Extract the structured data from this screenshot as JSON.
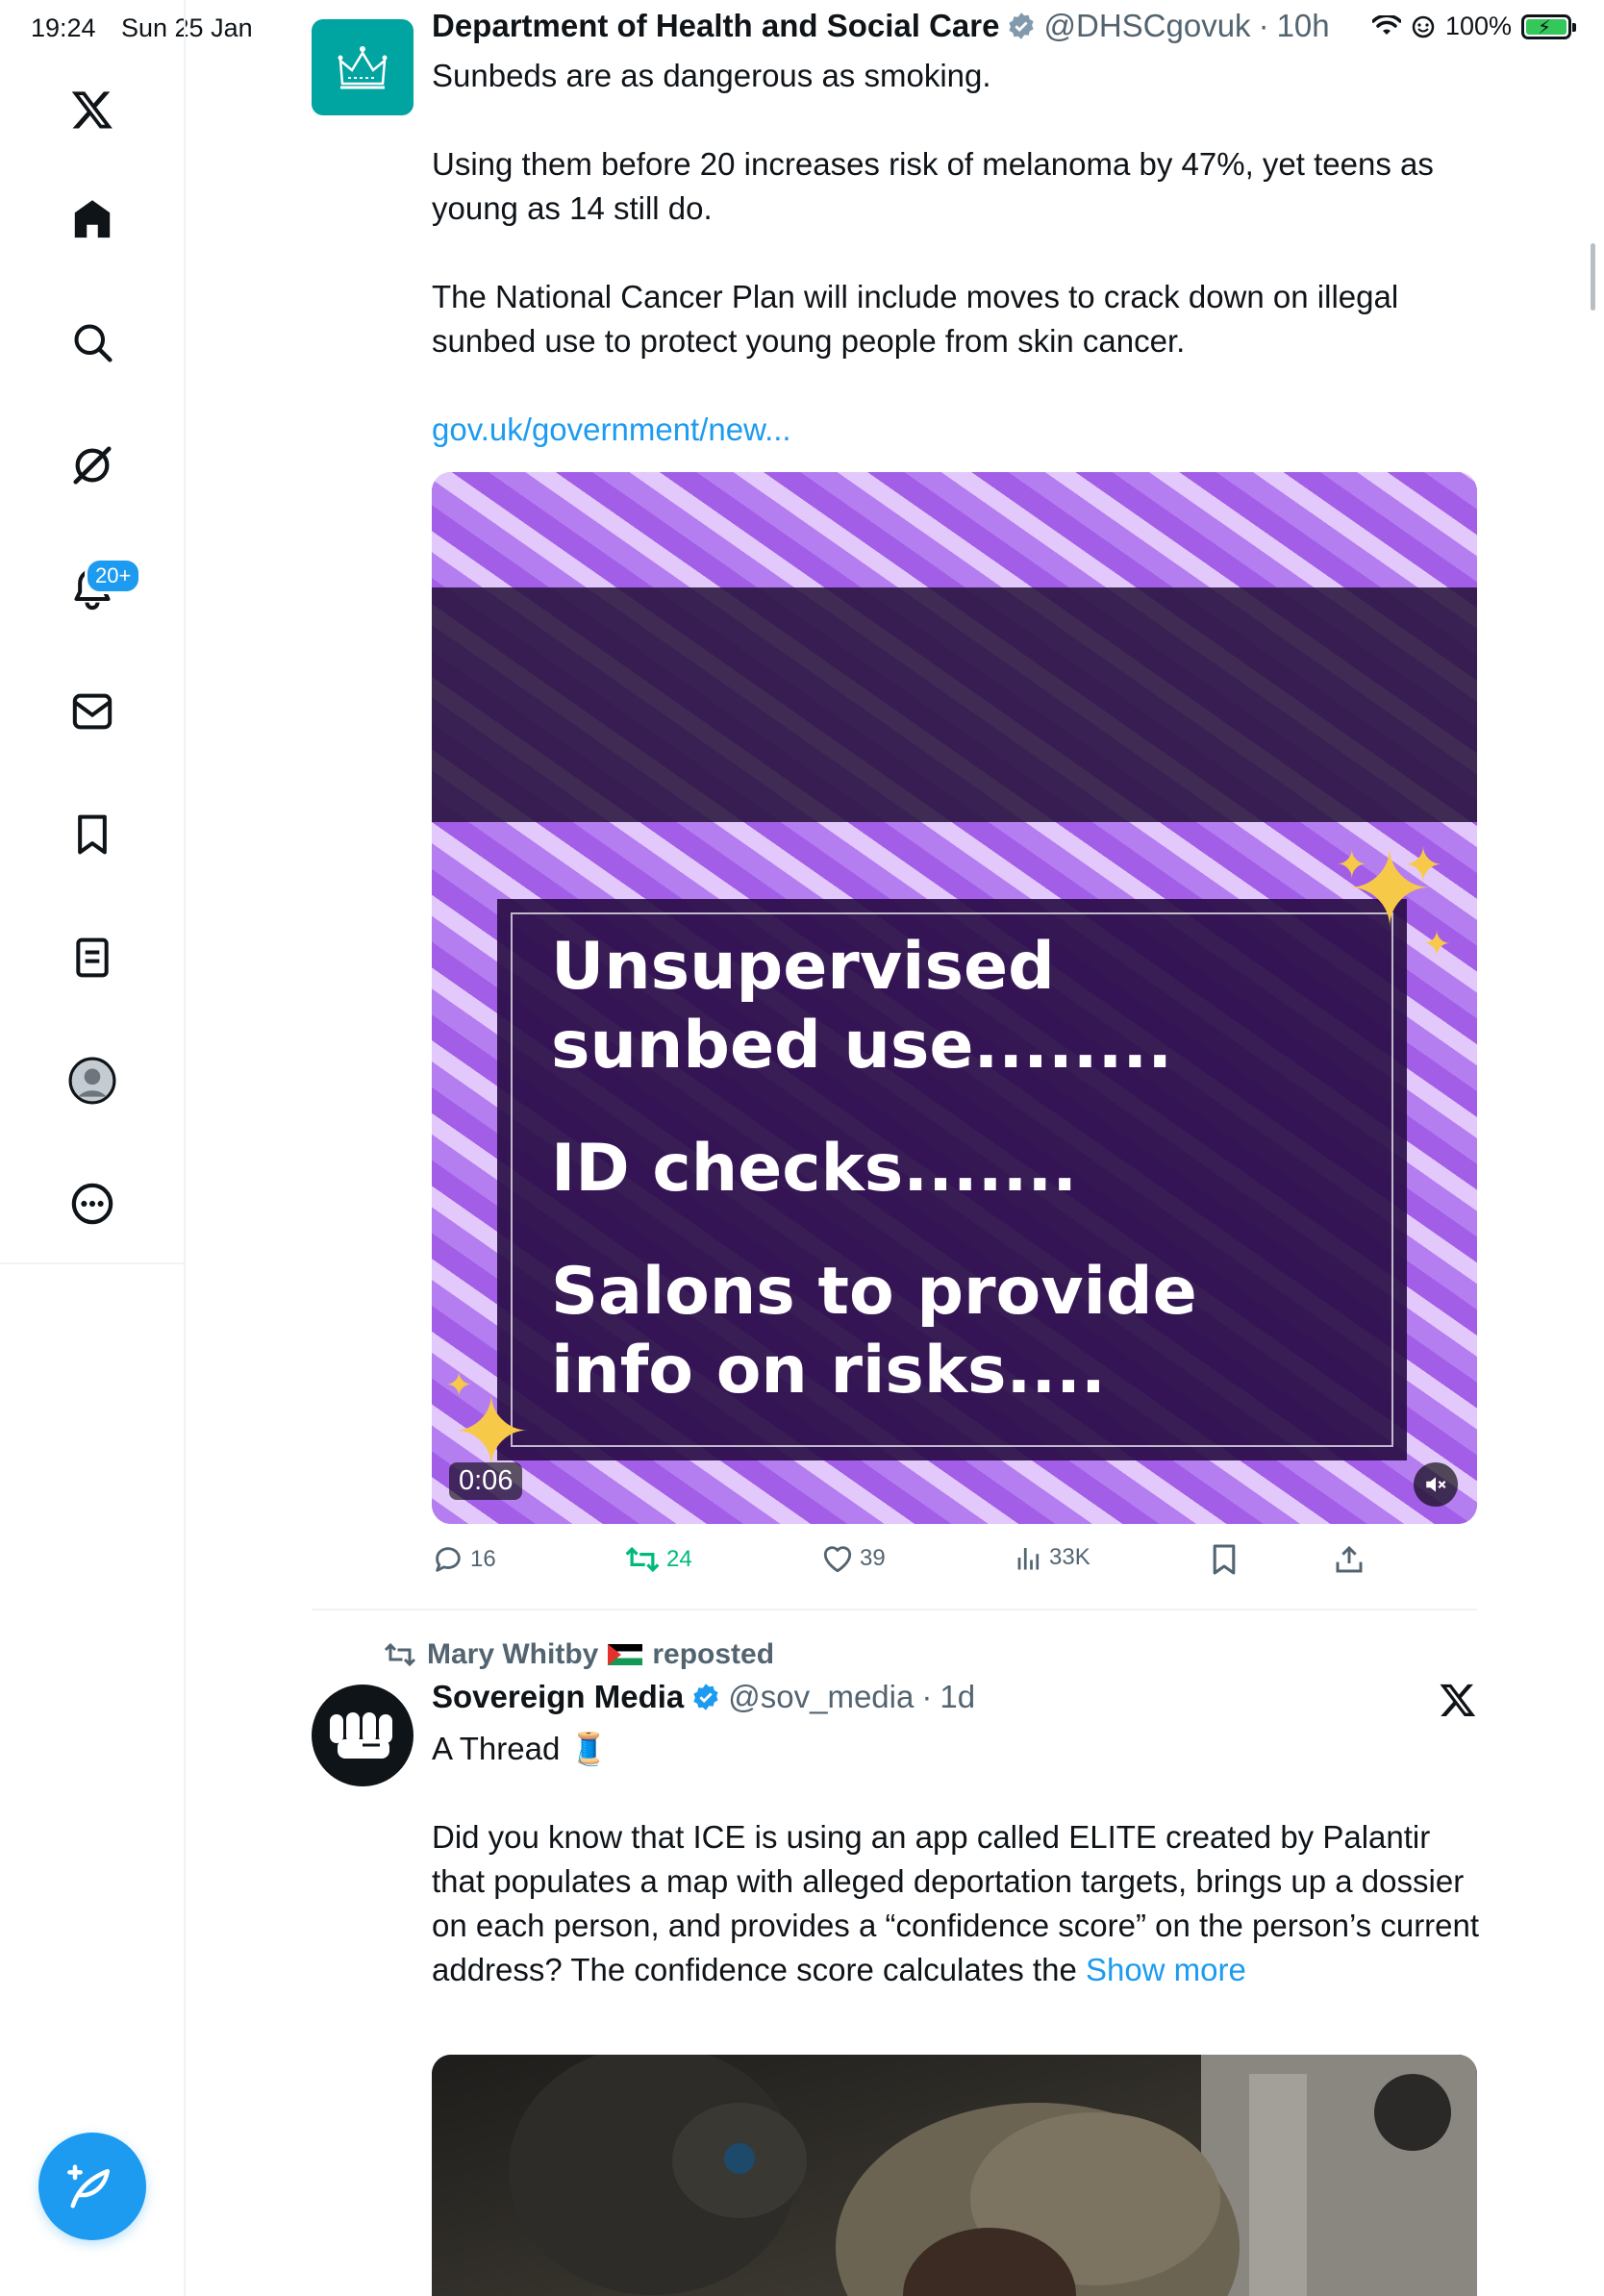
{
  "status_bar": {
    "time": "19:24",
    "date": "Sun 25 Jan",
    "battery": "100%",
    "battery_level": 1.0,
    "icons": [
      "wifi-icon",
      "focus-icon",
      "battery-icon"
    ]
  },
  "sidebar": {
    "items": [
      {
        "name": "x-logo-icon"
      },
      {
        "name": "home-icon"
      },
      {
        "name": "search-icon"
      },
      {
        "name": "grok-icon"
      },
      {
        "name": "notifications-icon"
      },
      {
        "name": "messages-icon"
      },
      {
        "name": "bookmarks-icon"
      },
      {
        "name": "lists-icon"
      },
      {
        "name": "profile-icon"
      },
      {
        "name": "more-icon"
      }
    ],
    "notifications_badge": "20+",
    "compose_icon": "compose-icon"
  },
  "tweets": [
    {
      "display_name": "Department of Health and Social Care",
      "handle": "@DHSCgovuk",
      "dot": "·",
      "time": "10h",
      "text_p1": "Sunbeds are as dangerous as smoking.",
      "text_p2": "Using them before 20 increases risk of melanoma by 47%, yet teens as young as 14 still do.",
      "text_p3": "The National Cancer Plan will include moves to crack down on illegal sunbed use to protect young people from skin cancer.",
      "link": "gov.uk/government/new...",
      "media": {
        "line1": "Unsupervised",
        "line2": "sunbed use........",
        "line3": "ID checks.......",
        "line4": "Salons to provide",
        "line5": "info on risks....",
        "duration": "0:06"
      },
      "actions": {
        "replies": "16",
        "reposts": "24",
        "likes": "39",
        "views": "33K"
      },
      "accent_color": "#00ba7c"
    },
    {
      "repost_by": "Mary Whitby",
      "repost_label": "reposted",
      "display_name": "Sovereign Media",
      "handle": "@sov_media",
      "dot": "·",
      "time": "1d",
      "text_p1": "A Thread 🧵",
      "text_p2": "Did you know that ICE is using an app called ELITE created by Palantir that populates a map with alleged deportation targets, brings up a dossier on each person, and provides a “confidence score” on the person’s current address? The confidence score calculates the",
      "show_more": "Show more"
    }
  ],
  "colors": {
    "accent": "#1d9bf0",
    "text": "#0f1419",
    "secondary": "#536471",
    "repost_green": "#00ba7c",
    "dhsc_teal": "#00a4a0"
  }
}
